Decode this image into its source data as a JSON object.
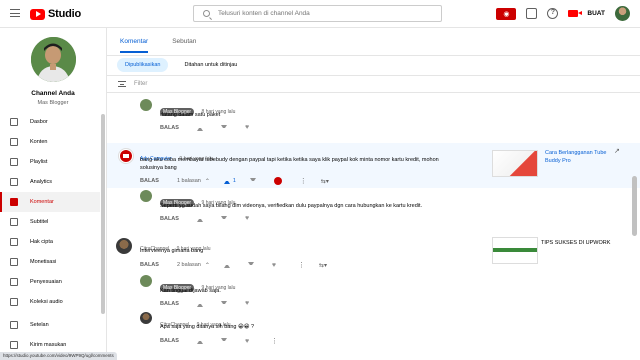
{
  "app": {
    "name": "Studio"
  },
  "search": {
    "placeholder": "Telusuri konten di channel Anda"
  },
  "topbar": {
    "create_label": "BUAT"
  },
  "channel": {
    "name": "Channel Anda",
    "subtitle": "Mas Blogger"
  },
  "sidebar": {
    "items": [
      {
        "label": "Dasbor",
        "icon": "dashboard-icon"
      },
      {
        "label": "Konten",
        "icon": "content-icon"
      },
      {
        "label": "Playlist",
        "icon": "playlist-icon"
      },
      {
        "label": "Analytics",
        "icon": "analytics-icon"
      },
      {
        "label": "Komentar",
        "icon": "comments-icon",
        "active": true
      },
      {
        "label": "Subtitel",
        "icon": "subtitles-icon"
      },
      {
        "label": "Hak cipta",
        "icon": "copyright-icon"
      },
      {
        "label": "Monetisasi",
        "icon": "monetization-icon"
      },
      {
        "label": "Penyesuaian",
        "icon": "customization-icon"
      },
      {
        "label": "Koleksi audio",
        "icon": "audio-library-icon"
      },
      {
        "label": "Setelan",
        "icon": "settings-icon"
      },
      {
        "label": "Kirim masukan",
        "icon": "feedback-icon"
      }
    ]
  },
  "tabs": [
    {
      "label": "Komentar",
      "active": true
    },
    {
      "label": "Sebutan",
      "active": false
    }
  ],
  "chips": [
    {
      "label": "Dipublikasikan",
      "active": true
    },
    {
      "label": "Ditahan untuk ditinjau",
      "active": false
    }
  ],
  "filter": {
    "placeholder": "Filter"
  },
  "comments": {
    "c1": {
      "author": "Mas Blogger",
      "time": "8 hari yang lalu",
      "text": "datang dalam satu paket"
    },
    "c2": {
      "author": "Ady Computer",
      "time": "9 hari yang lalu",
      "text": "bang aku coba membayar tubebudy dengan paypal tapi ketika ketika saya klik paypal kok minta nomor kartu kredit, mohon solusinya bang",
      "replies": "1 balasan",
      "likes": "1",
      "video_title": "Cara Berlangganan Tube Buddy Pro"
    },
    "c3": {
      "author": "Mas Blogger",
      "time": "9 hari yang lalu",
      "text": "Seperti yg sudah saya bilang dlm videonya, verifiedkan dulu paypalnya dgn cara hubungkan ke kartu kredit."
    },
    "c4": {
      "author": "CitraChannel",
      "time": "9 hari yang lalu",
      "text": "Intervieenya gimana bang",
      "replies": "2 balasan",
      "video_title": "TIPS SUKSES DI UPWORK"
    },
    "c5": {
      "author": "Mas Blogger",
      "time": "9 hari yang lalu",
      "text": "Kan tinggal dijawab saja."
    },
    "c6": {
      "author": "CitraChannel",
      "time": "9 hari yang lalu",
      "text": "Apa saja yang ditanya sih bang 😁😁 ?"
    }
  },
  "labels": {
    "reply": "BALAS"
  },
  "statusbar": {
    "url": "https://studio.youtube.com/video/9WP9Q/ugl/comments"
  },
  "colors": {
    "accent": "#065fd4",
    "brand": "#ff0000",
    "active_nav": "#cc0000"
  }
}
